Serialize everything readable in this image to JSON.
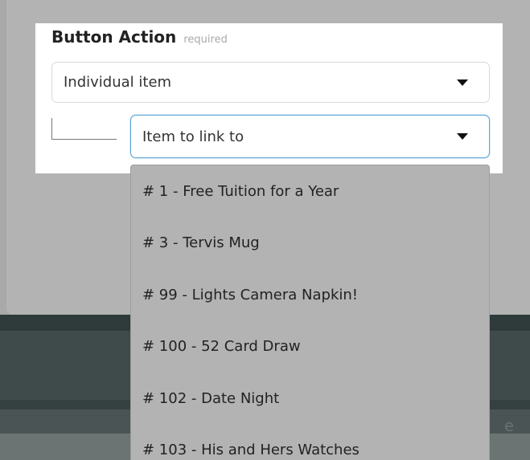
{
  "form": {
    "label": "Button Action",
    "required_text": "required",
    "action_select": {
      "value": "Individual item"
    },
    "item_select": {
      "value": "Item to link to"
    }
  },
  "dropdown": {
    "options": [
      "# 1 - Free Tuition for a Year",
      "# 3 - Tervis Mug",
      "# 99 - Lights Camera Napkin!",
      "# 100 - 52 Card Draw",
      "# 102 - Date Night",
      "# 103 - His and Hers Watches"
    ]
  },
  "background": {
    "partial_text": "e"
  }
}
